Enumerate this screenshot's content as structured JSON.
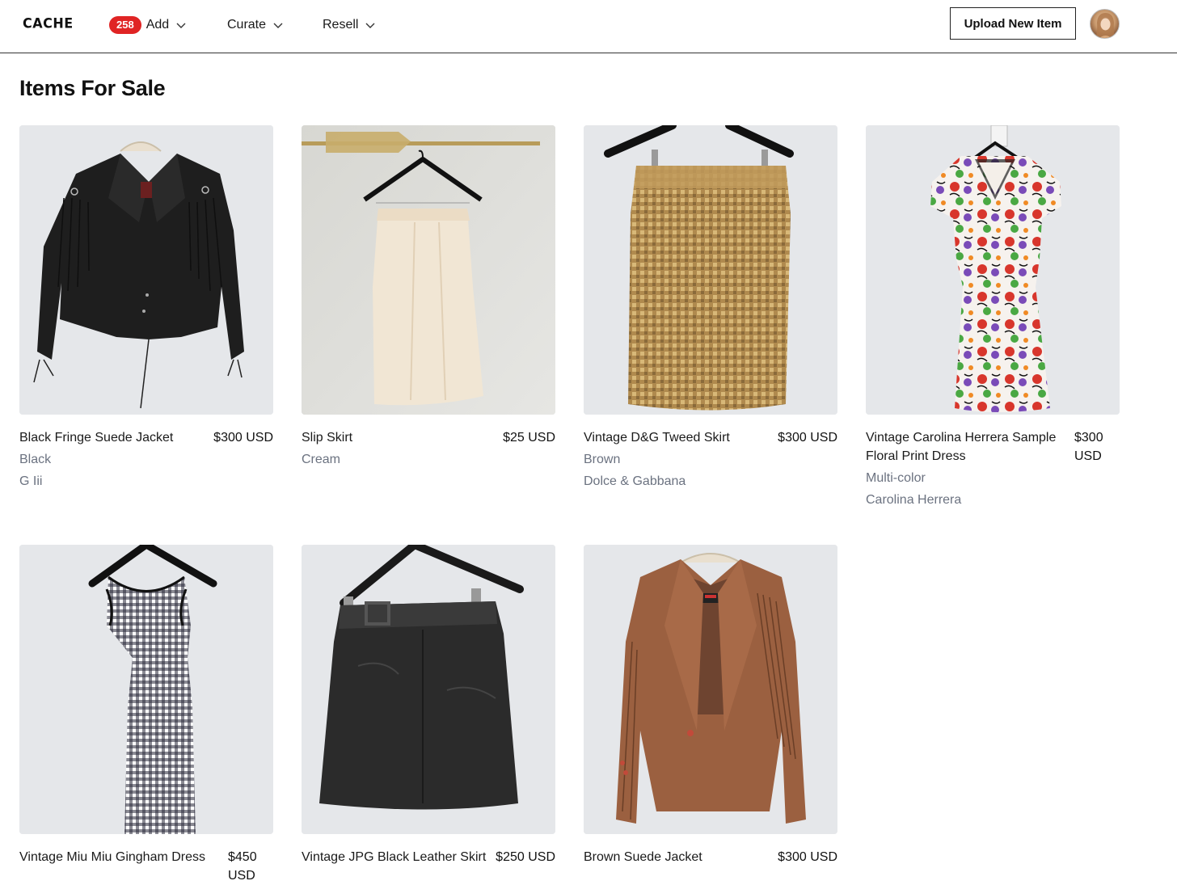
{
  "header": {
    "logo": "CACHE",
    "nav": {
      "add": {
        "badge": "258",
        "label": "Add"
      },
      "curate": {
        "label": "Curate"
      },
      "resell": {
        "label": "Resell"
      }
    },
    "upload_button": "Upload New Item",
    "avatar_icon": "user-avatar-photo"
  },
  "page": {
    "title": "Items For Sale"
  },
  "colors": {
    "badge": "#e02424",
    "card_background": "#e6e8ec",
    "meta_text": "#6b7280"
  },
  "items": [
    {
      "title": "Black Fringe Suede Jacket",
      "price": "$300 USD",
      "color": "Black",
      "brand": "G Iii"
    },
    {
      "title": "Slip Skirt",
      "price": "$25 USD",
      "color": "Cream",
      "brand": ""
    },
    {
      "title": "Vintage D&G Tweed Skirt",
      "price": "$300 USD",
      "color": "Brown",
      "brand": "Dolce & Gabbana"
    },
    {
      "title": "Vintage Carolina Herrera Sample Floral Print Dress",
      "price": "$300 USD",
      "color": "Multi-color",
      "brand": "Carolina Herrera"
    },
    {
      "title": "Vintage Miu Miu Gingham Dress",
      "price": "$450 USD",
      "color": "",
      "brand": ""
    },
    {
      "title": "Vintage JPG Black Leather Skirt",
      "price": "$250 USD",
      "color": "",
      "brand": ""
    },
    {
      "title": "Brown Suede Jacket",
      "price": "$300 USD",
      "color": "",
      "brand": ""
    }
  ]
}
